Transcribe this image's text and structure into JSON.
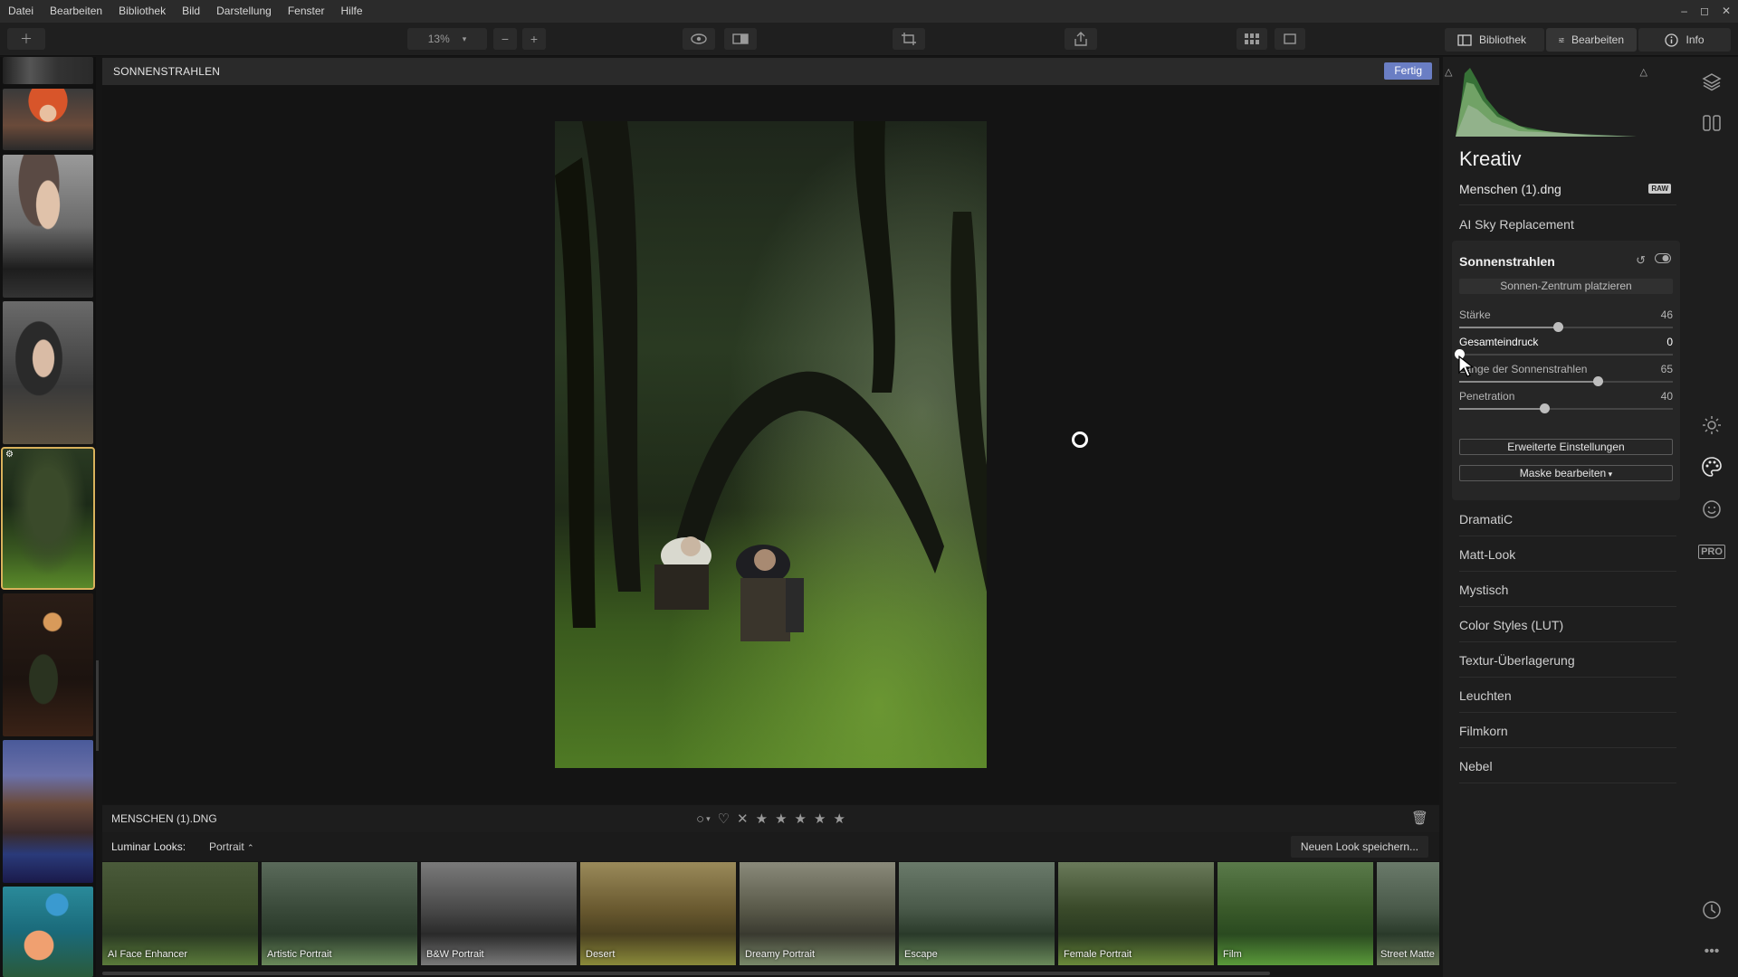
{
  "menu": [
    "Datei",
    "Bearbeiten",
    "Bibliothek",
    "Bild",
    "Darstellung",
    "Fenster",
    "Hilfe"
  ],
  "window_controls": [
    "–",
    "◻",
    "✕"
  ],
  "toolbar": {
    "zoom": "13%",
    "tabs": [
      {
        "label": "Bibliothek",
        "icon": "library-icon"
      },
      {
        "label": "Bearbeiten",
        "icon": "sliders-icon"
      },
      {
        "label": "Info",
        "icon": "info-icon"
      }
    ]
  },
  "image_header": {
    "title": "SONNENSTRAHLEN",
    "done_label": "Fertig"
  },
  "infobar": {
    "filename": "MENSCHEN (1).DNG",
    "stars": 5
  },
  "looks": {
    "label": "Luminar Looks:",
    "category": "Portrait",
    "save_label": "Neuen Look speichern...",
    "items": [
      "AI Face Enhancer",
      "Artistic Portrait",
      "B&W Portrait",
      "Desert",
      "Dreamy Portrait",
      "Escape",
      "Female Portrait",
      "Film",
      "Street Matte"
    ]
  },
  "panel": {
    "title": "Kreativ",
    "file_name": "Menschen (1).dng",
    "raw_badge": "RAW",
    "tool_above": "AI Sky Replacement",
    "tool": {
      "title": "Sonnenstrahlen",
      "place_button": "Sonnen-Zentrum platzieren",
      "sliders": [
        {
          "label": "Stärke",
          "value": 46,
          "fraction": 0.46
        },
        {
          "label": "Gesamteindruck",
          "value": 0,
          "fraction": 0.0
        },
        {
          "label": "Länge der Sonnenstrahlen",
          "value": 65,
          "fraction": 0.65
        },
        {
          "label": "Penetration",
          "value": 40,
          "fraction": 0.4
        }
      ],
      "advanced_button": "Erweiterte Einstellungen",
      "mask_button": "Maske bearbeiten"
    },
    "tools_below": [
      "DramatiC",
      "Matt-Look",
      "Mystisch",
      "Color Styles (LUT)",
      "Textur-Überlagerung",
      "Leuchten",
      "Filmkorn",
      "Nebel"
    ]
  },
  "side_icons": [
    "layers-icon",
    "compare-icon",
    "sun-icon",
    "palette-icon",
    "face-icon",
    "pro-icon",
    "history-icon",
    "more-icon"
  ],
  "colors": {
    "accent": "#6a7ec4",
    "selection": "#d9b25c"
  }
}
